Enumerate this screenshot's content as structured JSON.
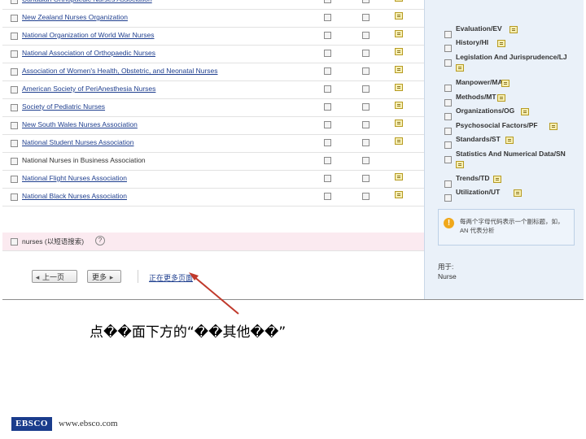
{
  "organizations": [
    {
      "name": "Canadian Orthopaedic Nurses Association",
      "link": true,
      "note": true
    },
    {
      "name": "New Zealand Nurses Organization",
      "link": true,
      "note": true
    },
    {
      "name": "National Organization of World War Nurses",
      "link": true,
      "note": true
    },
    {
      "name": "National Association of Orthopaedic Nurses",
      "link": true,
      "note": true
    },
    {
      "name": "Association of Women's Health, Obstetric, and Neonatal Nurses",
      "link": true,
      "note": true
    },
    {
      "name": "American Society of PeriAnesthesia Nurses",
      "link": true,
      "note": true
    },
    {
      "name": "Society of Pediatric Nurses",
      "link": true,
      "note": true
    },
    {
      "name": "New South Wales Nurses Association",
      "link": true,
      "note": true
    },
    {
      "name": "National Student Nurses Association",
      "link": true,
      "note": true
    },
    {
      "name": "National Nurses in Business Association",
      "link": false,
      "note": false
    },
    {
      "name": "National Flight Nurses Association",
      "link": true,
      "note": true
    },
    {
      "name": "National Black Nurses Association",
      "link": true,
      "note": true
    }
  ],
  "search_row": {
    "term": "nurses (以短语搜索)",
    "help": "?"
  },
  "pagination": {
    "prev_label": "上一页",
    "next_label": "更多"
  },
  "more_link": "正在更多页面",
  "subheadings": [
    "Evaluation/EV",
    "History/HI",
    "Legislation And Jurisprudence/LJ",
    "Manpower/MA",
    "Methods/MT",
    "Organizations/OG",
    "Psychosocial Factors/PF",
    "Standards/ST",
    "Statistics And Numerical Data/SN",
    "Trends/TD",
    "Utilization/UT"
  ],
  "info_text": "每两个字母代码表示一个副标题，如，AN 代表分析",
  "used_for": {
    "label": "用于:",
    "value": "Nurse"
  },
  "caption": "点��面下方的“��其他��”",
  "footer": {
    "logo": "EBSCO",
    "url": "www.ebsco.com"
  },
  "colors": {
    "link": "#1f3f8f",
    "panel": "#eaf1f9",
    "highlight_row": "#fbeaf0",
    "arrow": "#c0392b",
    "logo_bg": "#1a3c8c"
  }
}
